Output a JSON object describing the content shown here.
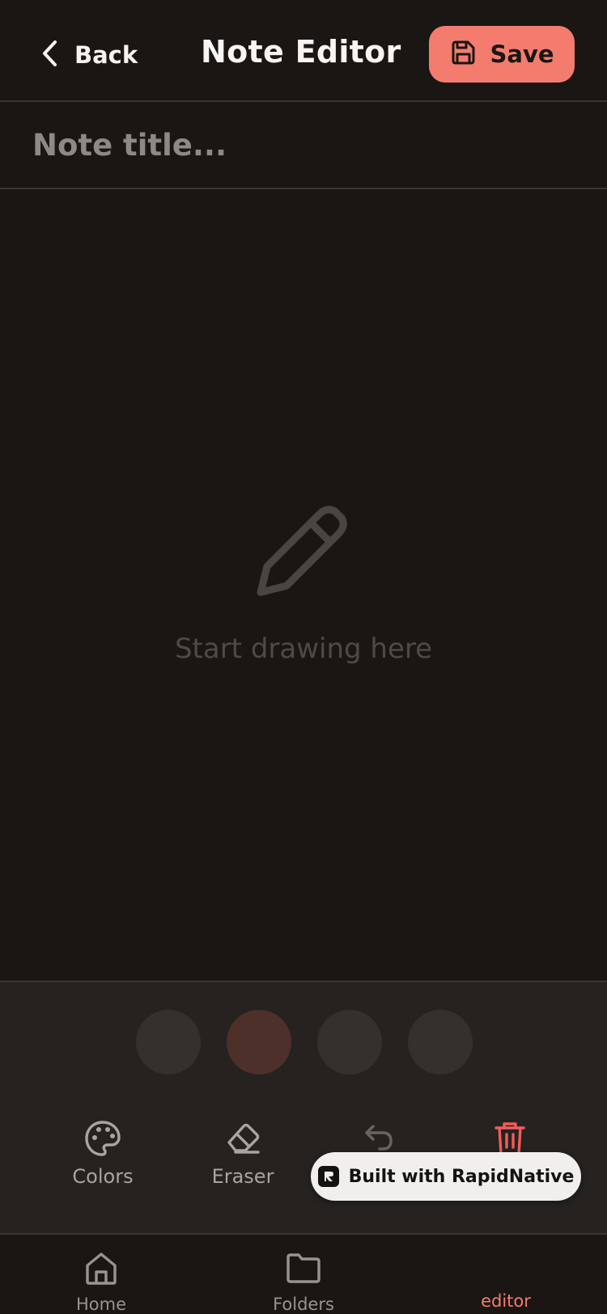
{
  "header": {
    "back_label": "Back",
    "title": "Note Editor",
    "save_label": "Save"
  },
  "title_field": {
    "placeholder": "Note title...",
    "value": ""
  },
  "canvas": {
    "hint": "Start drawing here"
  },
  "palette": {
    "swatches": [
      {
        "color": "#34302e",
        "selected": false
      },
      {
        "color": "#4e302b",
        "selected": true
      },
      {
        "color": "#34302e",
        "selected": false
      },
      {
        "color": "#34302e",
        "selected": false
      }
    ]
  },
  "tools": [
    {
      "icon": "palette-icon",
      "label": "Colors"
    },
    {
      "icon": "eraser-icon",
      "label": "Eraser"
    },
    {
      "icon": "undo-icon",
      "label": ""
    },
    {
      "icon": "trash-icon",
      "label": ""
    }
  ],
  "badge": {
    "label": "Built with RapidNative"
  },
  "nav": {
    "items": [
      {
        "icon": "home-icon",
        "label": "Home",
        "active": false
      },
      {
        "icon": "folder-icon",
        "label": "Folders",
        "active": false
      },
      {
        "icon": "",
        "label": "editor",
        "active": true
      }
    ]
  },
  "colors": {
    "accent": "#f47c6e",
    "background": "#1a1614",
    "panel": "#252220"
  }
}
